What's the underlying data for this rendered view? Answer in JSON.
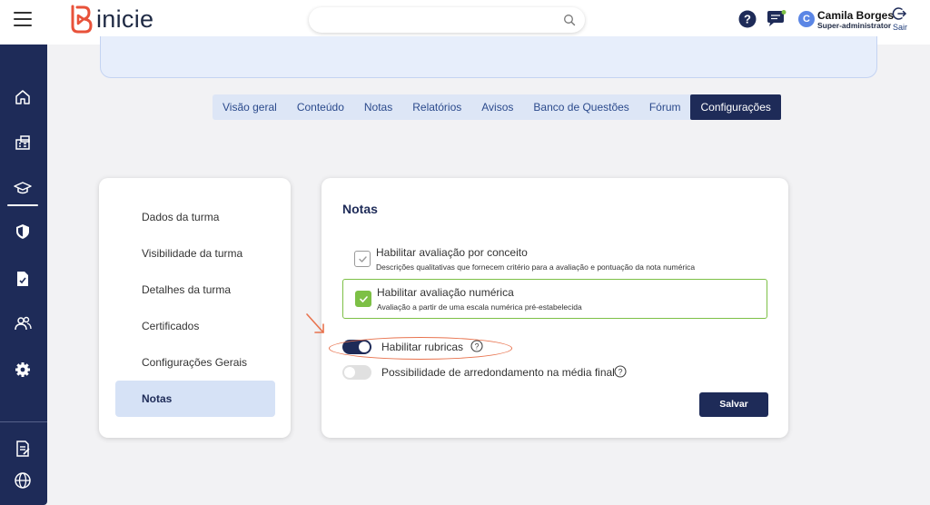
{
  "header": {
    "brand": "inicie",
    "search_placeholder": "",
    "user": {
      "initial": "C",
      "name": "Camila Borges",
      "role": "Super-administrator"
    },
    "logout_label": "Sair"
  },
  "colors": {
    "primary": "#1e2b58",
    "brand_red": "#e8523a",
    "accent_green": "#7dc046",
    "annotation_orange": "#e8734e"
  },
  "sidebar": {
    "icons": [
      "home-icon",
      "school-icon",
      "graduation-cap-icon",
      "shield-icon",
      "document-icon",
      "users-icon",
      "gear-icon",
      "report-icon",
      "globe-icon"
    ],
    "active": "graduation-cap-icon"
  },
  "tabs": [
    {
      "label": "Visão geral",
      "active": false
    },
    {
      "label": "Conteúdo",
      "active": false
    },
    {
      "label": "Notas",
      "active": false
    },
    {
      "label": "Relatórios",
      "active": false
    },
    {
      "label": "Avisos",
      "active": false
    },
    {
      "label": "Banco de Questões",
      "active": false
    },
    {
      "label": "Fórum",
      "active": false
    },
    {
      "label": "Configurações",
      "active": true
    }
  ],
  "menu": {
    "items": [
      {
        "label": "Dados da turma",
        "active": false
      },
      {
        "label": "Visibilidade da turma",
        "active": false
      },
      {
        "label": "Detalhes da turma",
        "active": false
      },
      {
        "label": "Certificados",
        "active": false
      },
      {
        "label": "Configurações Gerais",
        "active": false
      },
      {
        "label": "Notas",
        "active": true
      }
    ]
  },
  "settings": {
    "title": "Notas",
    "options": [
      {
        "label": "Habilitar avaliação por conceito",
        "description": "Descrições qualitativas que fornecem critério para a avaliação e pontuação da nota numérica",
        "checked": false
      },
      {
        "label": "Habilitar avaliação numérica",
        "description": "Avaliação a partir de uma escala numérica pré-estabelecida",
        "checked": true
      }
    ],
    "toggles": [
      {
        "label": "Habilitar rubricas",
        "on": true
      },
      {
        "label": "Possibilidade de arredondamento na média final",
        "on": false
      }
    ],
    "save_label": "Salvar"
  }
}
